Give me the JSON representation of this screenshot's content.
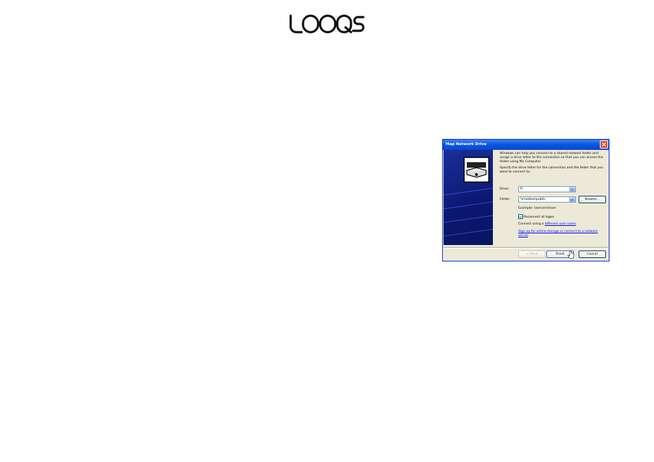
{
  "logo": {
    "text": "LOOQS"
  },
  "dialog": {
    "title": "Map Network Drive",
    "intro": "Windows can help you connect to a shared network folder and assign a drive letter to the connection so that you can access the folder using My Computer.",
    "specify": "Specify the drive letter for the connection and the folder that you want to connect to:",
    "drive_label": "Drive:",
    "drive_value": "P:",
    "folder_label": "Folder:",
    "folder_value": "\\\\meebox\\public",
    "browse_label": "Browse...",
    "example": "Example: \\\\server\\share",
    "reconnect_label": "Reconnect at logon",
    "reconnect_checked": true,
    "connect_prefix": "Connect using a ",
    "connect_link": "different user name",
    "connect_suffix": ".",
    "signup_link": "Sign up for online storage or connect to a network server",
    "signup_suffix": ".",
    "back_label": "< Back",
    "finish_label": "Finish",
    "cancel_label": "Cancel"
  },
  "colors": {
    "titlebar": "#0a54e3",
    "banner": "#0b1670",
    "dialog_bg": "#ece9d8"
  }
}
